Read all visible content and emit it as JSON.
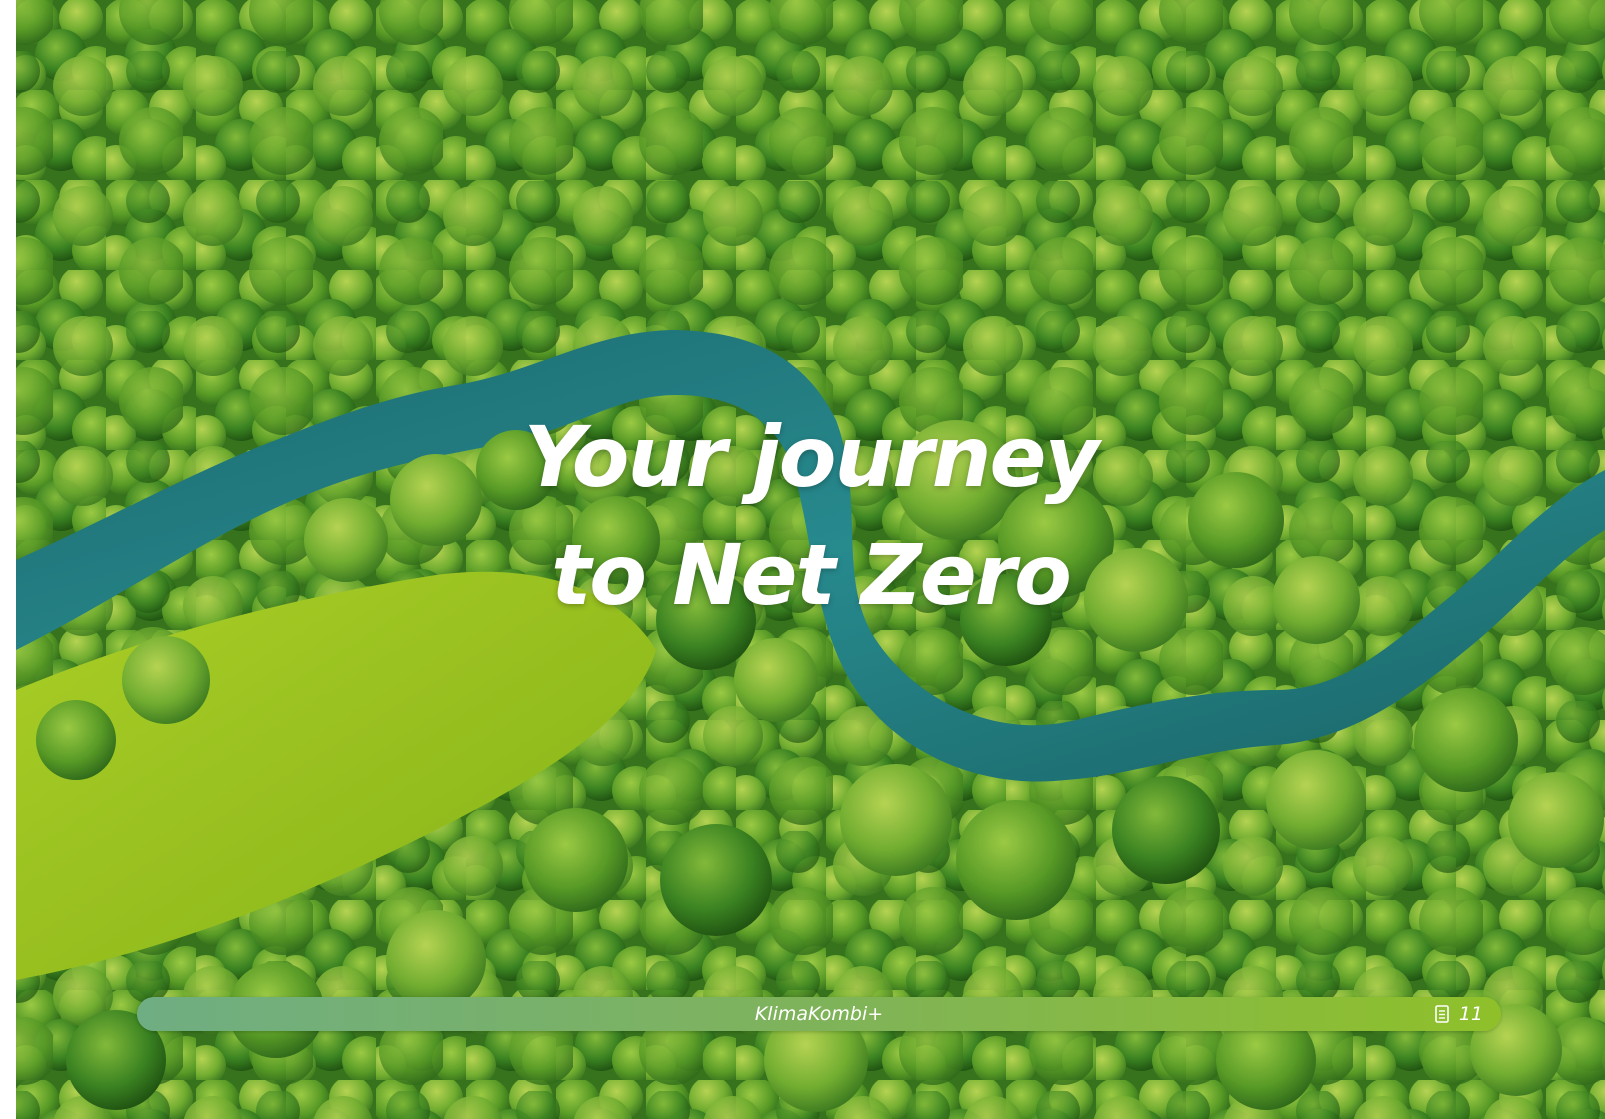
{
  "title": {
    "line1": "Your journey",
    "line2": "to Net Zero"
  },
  "footer": {
    "label": "KlimaKombi+",
    "page_number": "11",
    "page_icon": "document-icon"
  },
  "colors": {
    "forest_dark": "#2f6b1c",
    "forest_light": "#8cc63f",
    "river": "#1f7f86",
    "meadow": "#a6d123",
    "footer_start": "#6fae83",
    "footer_end": "#8fc02a"
  }
}
